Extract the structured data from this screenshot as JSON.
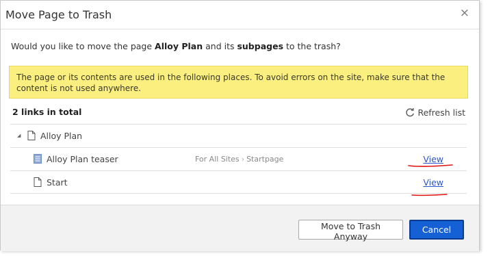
{
  "dialog": {
    "title": "Move Page to Trash",
    "close_symbol": "×"
  },
  "question": {
    "prefix": "Would you like to move the page ",
    "page_name": "Alloy Plan",
    "middle": " and its ",
    "subpages": "subpages",
    "suffix": " to the trash?"
  },
  "warning": {
    "text": "The page or its contents are used in the following places. To avoid errors on the site, make sure that the content is not used anywhere."
  },
  "links": {
    "count_label": "2 links in total",
    "refresh_label": "Refresh list"
  },
  "tree": {
    "root": {
      "label": "Alloy Plan",
      "icon": "page-icon",
      "expanded": true
    },
    "items": [
      {
        "label": "Alloy Plan teaser",
        "icon": "block-icon",
        "path": [
          "For All Sites",
          "Startpage"
        ],
        "action": "View"
      },
      {
        "label": "Start",
        "icon": "page-icon",
        "path": [],
        "action": "View"
      }
    ]
  },
  "footer": {
    "secondary_label": "Move to Trash Anyway",
    "primary_label": "Cancel"
  },
  "colors": {
    "warning_bg": "#fbef7f",
    "primary_button": "#1560d4",
    "link": "#2a55cc",
    "annotation_red": "#e01010"
  }
}
